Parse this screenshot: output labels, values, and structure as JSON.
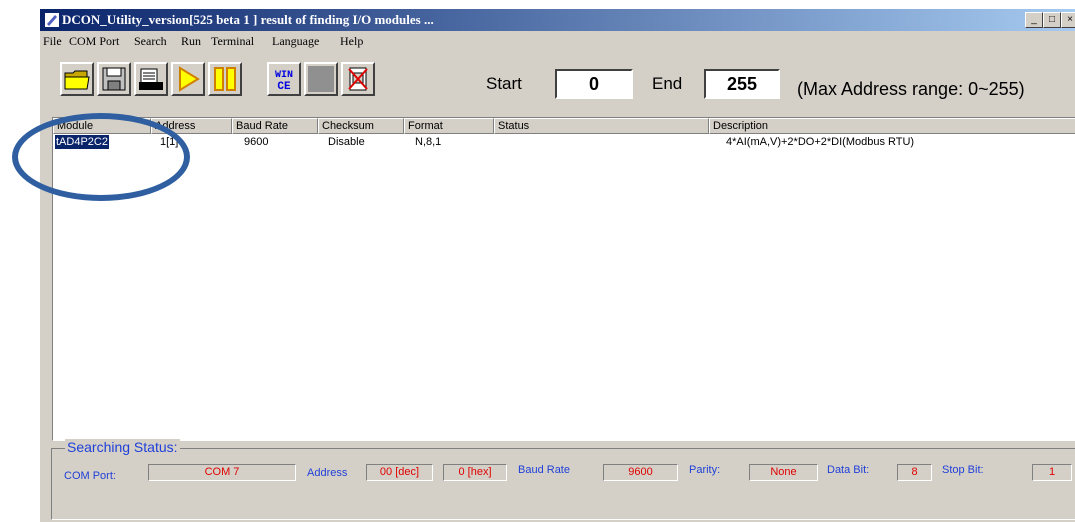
{
  "window": {
    "title": "DCON_Utility_version[525 beta 1 ] result of finding I/O modules ...",
    "controls": [
      "_",
      "□",
      "×"
    ]
  },
  "menu": [
    "File",
    "COM Port",
    "Search",
    "Run",
    "Terminal",
    "Language",
    "Help"
  ],
  "toolbar": {
    "icons": [
      "open-folder-icon",
      "save-disk-icon",
      "printer-icon",
      "play-icon",
      "pause-icon",
      "wince-icon",
      "blank-icon",
      "disconnect-icon"
    ],
    "wince_text_top": "WIN",
    "wince_text_bottom": "CE"
  },
  "range": {
    "start_label": "Start",
    "start_value": "0",
    "end_label": "End",
    "end_value": "255",
    "max_text": "(Max Address range: 0~255)"
  },
  "table": {
    "columns": [
      "Module",
      "Address",
      "Baud Rate",
      "Checksum",
      "Format",
      "Status",
      "Description"
    ],
    "rows": [
      {
        "module": "tAD4P2C2",
        "address": "1[1]",
        "baud": "9600",
        "checksum": "Disable",
        "format": "N,8,1",
        "status": "",
        "description": "4*AI(mA,V)+2*DO+2*DI(Modbus RTU)"
      }
    ]
  },
  "status": {
    "title": "Searching Status:",
    "com_port_label": "COM Port:",
    "com_port_value": "COM 7",
    "address_label": "Address",
    "address_dec": "00 [dec]",
    "address_hex": "0 [hex]",
    "baud_label": "Baud Rate",
    "baud_value": "9600",
    "parity_label": "Parity:",
    "parity_value": "None",
    "databit_label": "Data Bit:",
    "databit_value": "8",
    "stopbit_label": "Stop Bit:",
    "stopbit_value": "1"
  },
  "colors": {
    "highlight_ring": "#2f5fa0",
    "status_label": "#1f3fd8",
    "status_value": "#e00000"
  }
}
